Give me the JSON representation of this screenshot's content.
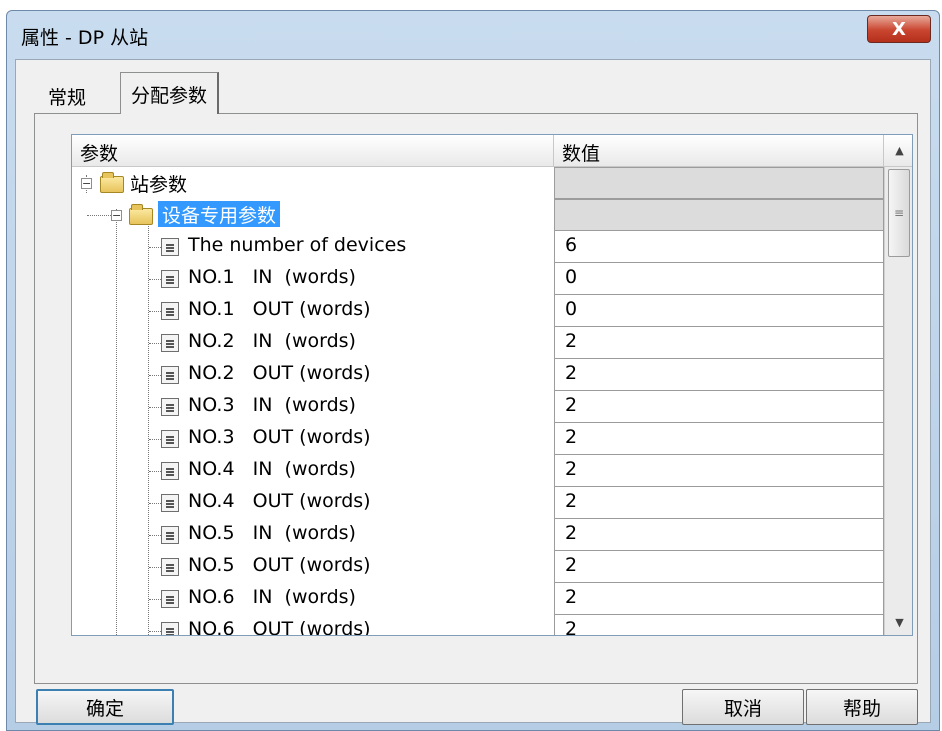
{
  "window": {
    "title": "属性 - DP 从站",
    "close_label": "X"
  },
  "tabs": [
    {
      "label": "常规",
      "active": false
    },
    {
      "label": "分配参数",
      "active": true
    }
  ],
  "grid": {
    "columns": {
      "param": "参数",
      "value": "数值"
    },
    "tree": {
      "station_params_label": "站参数",
      "device_params_label": "设备专用参数"
    },
    "rows": [
      {
        "label": "The number of devices",
        "value": "6"
      },
      {
        "label": "NO.1   IN  (words)",
        "value": "0"
      },
      {
        "label": "NO.1   OUT (words)",
        "value": "0"
      },
      {
        "label": "NO.2   IN  (words)",
        "value": "2"
      },
      {
        "label": "NO.2   OUT (words)",
        "value": "2"
      },
      {
        "label": "NO.3   IN  (words)",
        "value": "2"
      },
      {
        "label": "NO.3   OUT (words)",
        "value": "2"
      },
      {
        "label": "NO.4   IN  (words)",
        "value": "2"
      },
      {
        "label": "NO.4   OUT (words)",
        "value": "2"
      },
      {
        "label": "NO.5   IN  (words)",
        "value": "2"
      },
      {
        "label": "NO.5   OUT (words)",
        "value": "2"
      },
      {
        "label": "NO.6   IN  (words)",
        "value": "2"
      },
      {
        "label": "NO.6   OUT (words)",
        "value": "2"
      }
    ]
  },
  "scrollbar": {
    "up_arrow": "▲",
    "down_arrow": "▼",
    "grip": "≡"
  },
  "buttons": {
    "ok": "确定",
    "cancel": "取消",
    "help": "帮助"
  },
  "colors": {
    "selection": "#3399ff",
    "close_button": "#c9452f"
  }
}
